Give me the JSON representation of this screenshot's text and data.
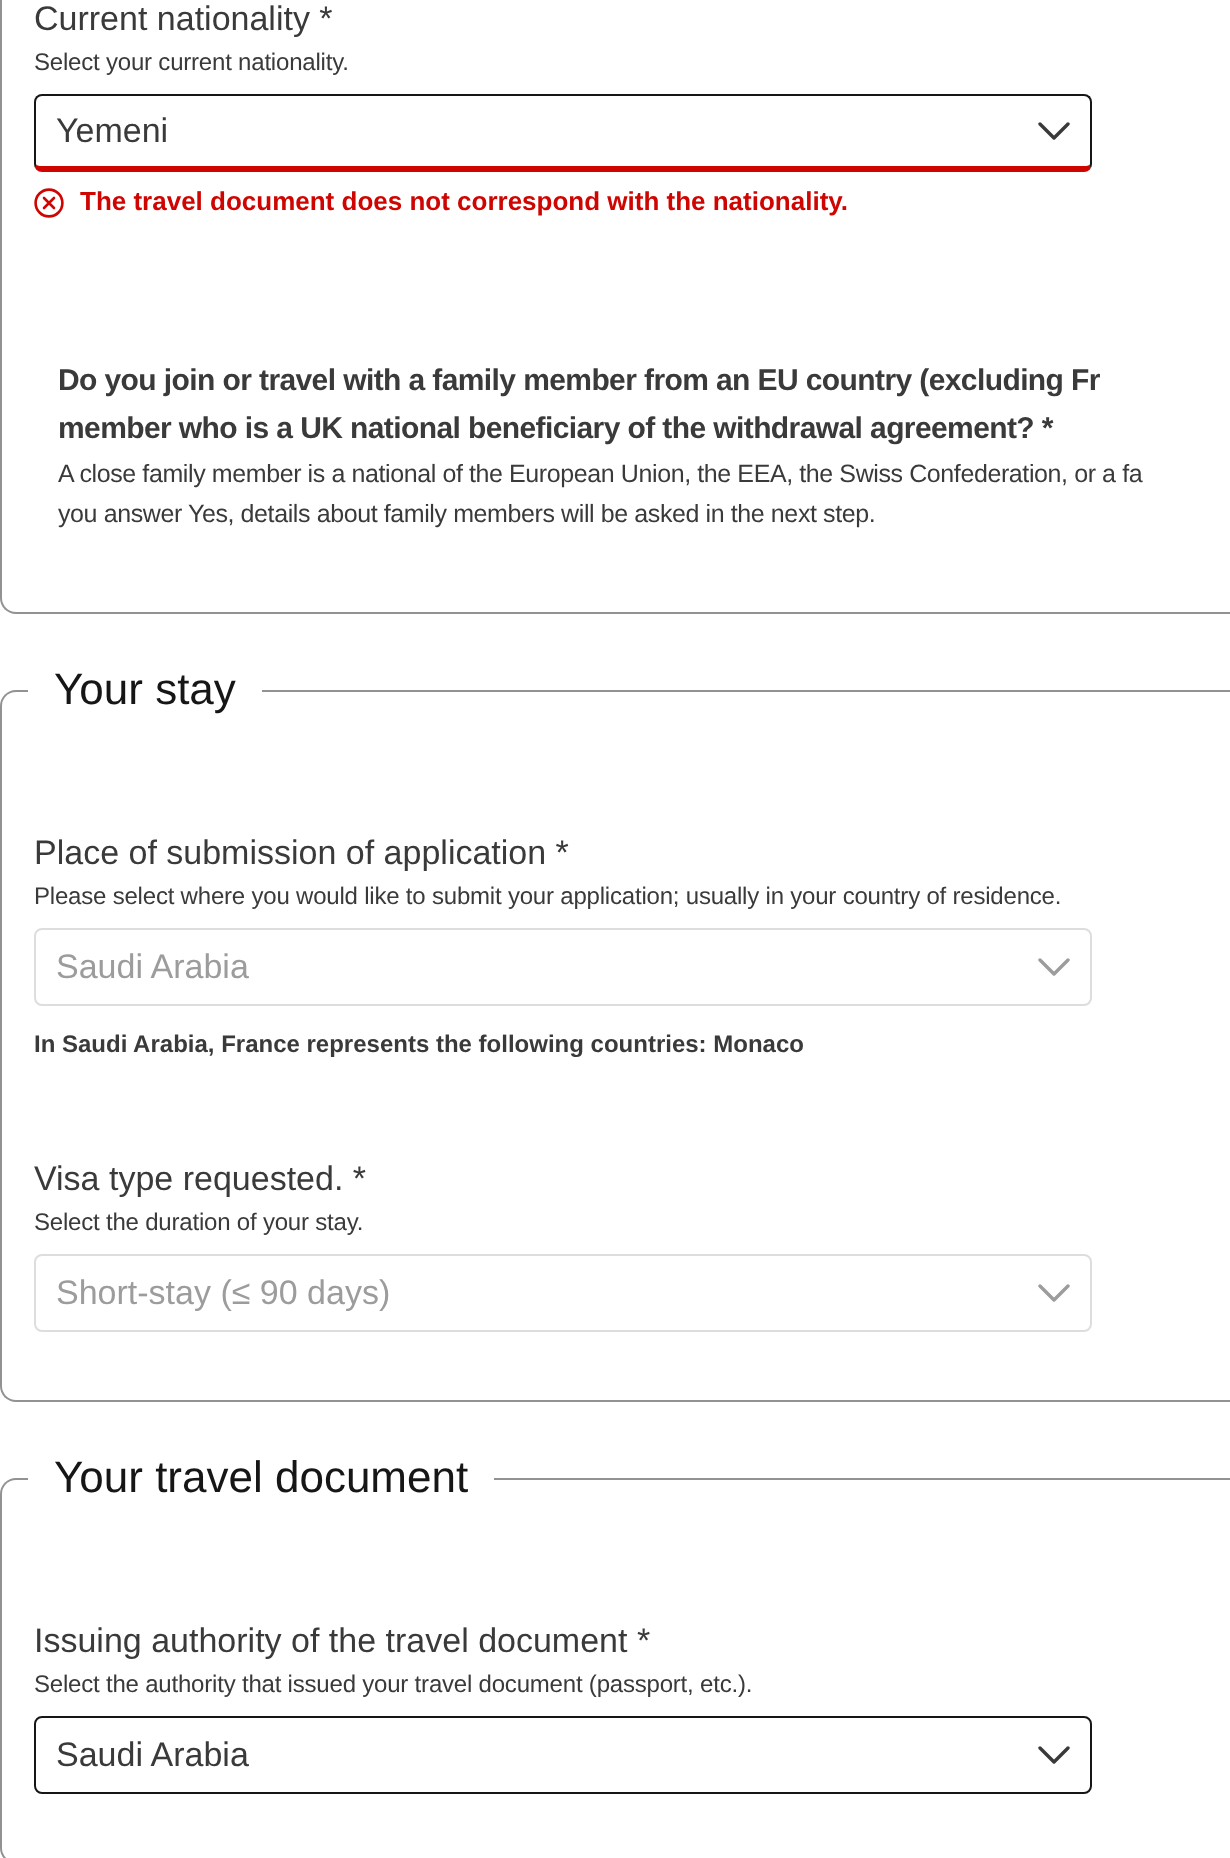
{
  "sections": [
    {
      "items": [
        {
          "kind": "select",
          "label": "Current nationality *",
          "hint": "Select your current nationality.",
          "value": "Yemeni",
          "disabled": false,
          "error": "The travel document does not correspond with the nationality."
        },
        {
          "kind": "question",
          "lines": [
            "Do you join or travel with a family member from an EU country (excluding Fr",
            "member who is a UK national beneficiary of the withdrawal agreement? *"
          ],
          "hint_lines": [
            "A close family member is a national of the European Union, the EEA, the Swiss Confederation, or a fa",
            "you answer Yes, details about family members will be asked in the next step."
          ]
        }
      ]
    },
    {
      "legend": "Your stay",
      "items": [
        {
          "kind": "select",
          "label": "Place of submission of application *",
          "hint": "Please select where you would like to submit your application; usually in your country of residence.",
          "value": "Saudi Arabia",
          "disabled": true,
          "note": "In Saudi Arabia, France represents the following countries: Monaco"
        },
        {
          "kind": "select",
          "label": "Visa type requested. *",
          "hint": "Select the duration of your stay.",
          "value": "Short-stay (≤ 90 days)",
          "disabled": true
        }
      ]
    },
    {
      "legend": "Your travel document",
      "items": [
        {
          "kind": "select",
          "label": "Issuing authority of the travel document *",
          "hint": "Select the authority that issued your travel document (passport, etc.).",
          "value": "Saudi Arabia",
          "disabled": false
        }
      ]
    }
  ]
}
